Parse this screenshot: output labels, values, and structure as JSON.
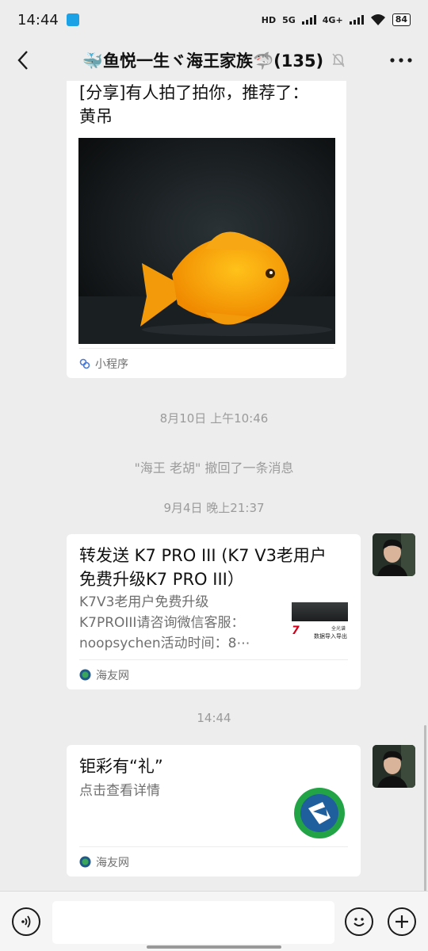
{
  "status_bar": {
    "time": "14:44",
    "network_1": "5G",
    "network_2": "4G+",
    "hd_label": "HD",
    "battery": "84",
    "app_icon": "app-notification-icon"
  },
  "header": {
    "title": "🐳鱼悦一生ヾ海王家族🦈(135)",
    "back_icon": "back-arrow-icon",
    "mute_icon": "bell-muted-icon",
    "more_icon": "more-dots-icon"
  },
  "messages": {
    "share_card": {
      "title_line1": "[分享]有人拍了拍你，推荐了：",
      "title_line2": "黄吊",
      "footer": "小程序"
    },
    "time_1": "8月10日 上午10:46",
    "recall_notice": "\"海王 老胡\" 撤回了一条消息",
    "time_2": "9月4日 晚上21:37",
    "article_1": {
      "title_line1": "转发送 K7 PRO III (K7 V3老用户",
      "title_line2": "免费升级K7 PRO III）",
      "desc_line1": "K7V3老用户免费升级",
      "desc_line2": "K7PROIII请咨询微信客服：",
      "desc_line3": "noopsychen活动时间：8⋯",
      "thumb_text_1": "全光谱",
      "thumb_text_2": "数据导入导出",
      "thumb_mark": "7",
      "footer": "海友网"
    },
    "time_3": "14:44",
    "article_2": {
      "title": "钜彩有“礼”",
      "desc": "点击查看详情",
      "footer": "海友网"
    }
  },
  "input_bar": {
    "voice_icon": "voice-icon",
    "emoji_icon": "emoji-icon",
    "plus_icon": "plus-icon"
  }
}
